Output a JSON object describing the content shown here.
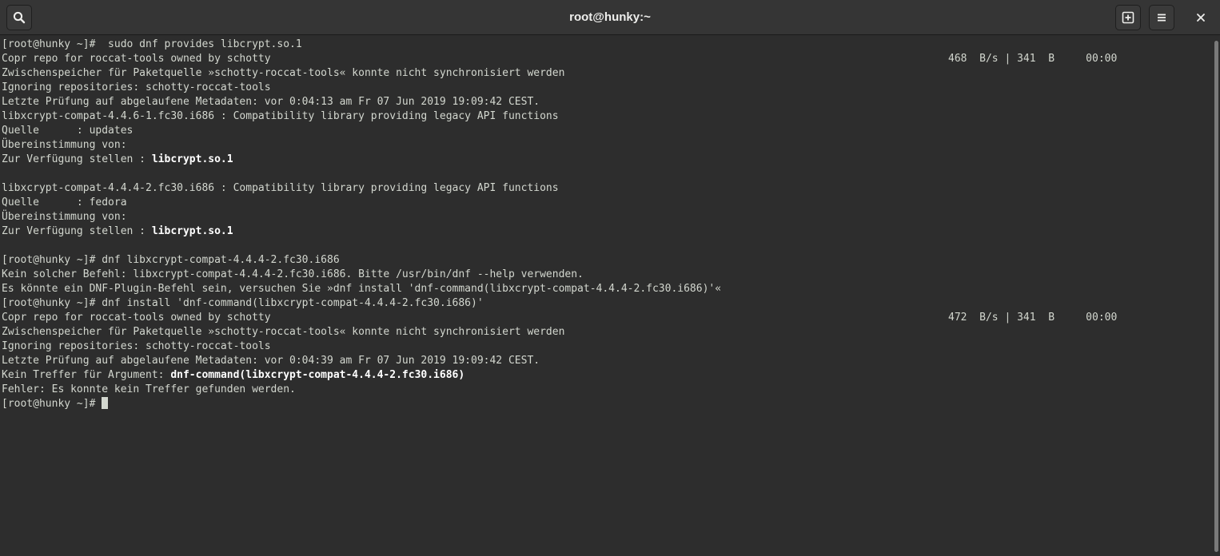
{
  "window": {
    "title": "root@hunky:~"
  },
  "headerbar": {
    "search_icon": "search-icon",
    "new_tab_icon": "new-tab-icon",
    "menu_icon": "hamburger-menu-icon",
    "close_icon": "close-icon"
  },
  "colors": {
    "headerbar_bg": "#353535",
    "terminal_bg": "#2d2d2d",
    "terminal_fg": "#d3d7cf",
    "bold_fg": "#ffffff"
  },
  "terminal": {
    "lines": [
      {
        "text": "[root@hunky ~]#  sudo dnf provides libcrypt.so.1"
      },
      {
        "text": "Copr repo for roccat-tools owned by schotty",
        "right": "468  B/s | 341  B     00:00"
      },
      {
        "text": "Zwischenspeicher für Paketquelle »schotty-roccat-tools« konnte nicht synchronisiert werden"
      },
      {
        "text": "Ignoring repositories: schotty-roccat-tools"
      },
      {
        "text": "Letzte Prüfung auf abgelaufene Metadaten: vor 0:04:13 am Fr 07 Jun 2019 19:09:42 CEST."
      },
      {
        "text": "libxcrypt-compat-4.4.6-1.fc30.i686 : Compatibility library providing legacy API functions"
      },
      {
        "text": "Quelle      : updates"
      },
      {
        "text": "Übereinstimmung von:"
      },
      {
        "text": "Zur Verfügung stellen : ",
        "bold": "libcrypt.so.1"
      },
      {
        "text": ""
      },
      {
        "text": "libxcrypt-compat-4.4.4-2.fc30.i686 : Compatibility library providing legacy API functions"
      },
      {
        "text": "Quelle      : fedora"
      },
      {
        "text": "Übereinstimmung von:"
      },
      {
        "text": "Zur Verfügung stellen : ",
        "bold": "libcrypt.so.1"
      },
      {
        "text": ""
      },
      {
        "text": "[root@hunky ~]# dnf libxcrypt-compat-4.4.4-2.fc30.i686"
      },
      {
        "text": "Kein solcher Befehl: libxcrypt-compat-4.4.4-2.fc30.i686. Bitte /usr/bin/dnf --help verwenden."
      },
      {
        "text": "Es könnte ein DNF-Plugin-Befehl sein, versuchen Sie »dnf install 'dnf-command(libxcrypt-compat-4.4.4-2.fc30.i686)'«"
      },
      {
        "text": "[root@hunky ~]# dnf install 'dnf-command(libxcrypt-compat-4.4.4-2.fc30.i686)'"
      },
      {
        "text": "Copr repo for roccat-tools owned by schotty",
        "right": "472  B/s | 341  B     00:00"
      },
      {
        "text": "Zwischenspeicher für Paketquelle »schotty-roccat-tools« konnte nicht synchronisiert werden"
      },
      {
        "text": "Ignoring repositories: schotty-roccat-tools"
      },
      {
        "text": "Letzte Prüfung auf abgelaufene Metadaten: vor 0:04:39 am Fr 07 Jun 2019 19:09:42 CEST."
      },
      {
        "text": "Kein Treffer für Argument: ",
        "bold": "dnf-command(libxcrypt-compat-4.4.4-2.fc30.i686)"
      },
      {
        "text": "Fehler: Es konnte kein Treffer gefunden werden."
      }
    ],
    "prompt": "[root@hunky ~]# "
  }
}
